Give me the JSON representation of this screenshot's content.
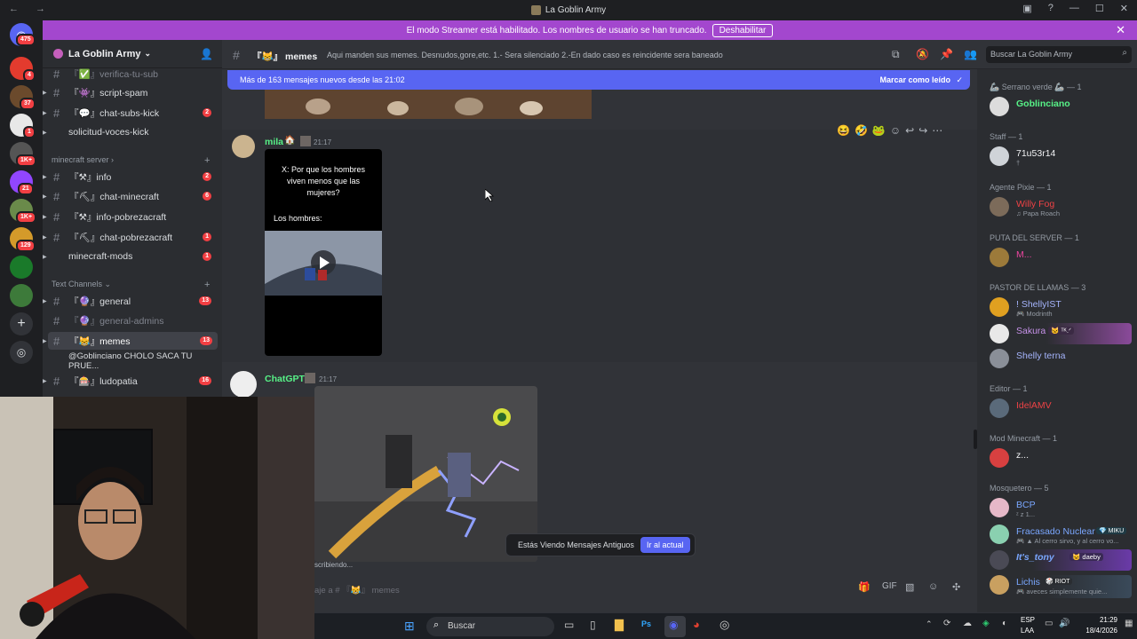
{
  "window": {
    "title": "La Goblin Army"
  },
  "banner": {
    "text": "El modo Streamer está habilitado. Los nombres de usuario se han truncado.",
    "button": "Deshabilitar"
  },
  "servers": {
    "badges": [
      "4",
      "37",
      "1",
      "1K+",
      "21",
      "1K+",
      "129"
    ],
    "top_badge": "475"
  },
  "guild": {
    "name": "La Goblin Army"
  },
  "channels": [
    {
      "name": "verifica-tu-sub",
      "prefix": "『✅』",
      "count": "",
      "muted": true
    },
    {
      "name": "script-spam",
      "prefix": "『👾』",
      "count": ""
    },
    {
      "name": "chat-subs-kick",
      "prefix": "『💬』",
      "count": "2"
    },
    {
      "name": "solicitud-voces-kick",
      "prefix": "",
      "count": ""
    }
  ],
  "categories": {
    "minecraft": "minecraft server",
    "text": "Text Channels"
  },
  "minecraft_channels": [
    {
      "name": "info",
      "prefix": "『⚒』",
      "count": "2"
    },
    {
      "name": "chat-minecraft",
      "prefix": "『⛏』",
      "count": "6"
    },
    {
      "name": "info-pobrezacraft",
      "prefix": "『⚒』",
      "count": ""
    },
    {
      "name": "chat-pobrezacraft",
      "prefix": "『⛏』",
      "count": "1"
    },
    {
      "name": "minecraft-mods",
      "prefix": "",
      "count": "1"
    }
  ],
  "text_channels": [
    {
      "name": "general",
      "prefix": "『🔮』",
      "count": "13"
    },
    {
      "name": "general-admins",
      "prefix": "『🔮』",
      "count": "",
      "muted": true
    },
    {
      "name": "memes",
      "prefix": "『😹』",
      "count": "13",
      "selected": true
    },
    {
      "name": "@Goblinciano CHOLO SACA TU PRUE...",
      "prefix": "",
      "count": "",
      "thread": true
    },
    {
      "name": "ludopatia",
      "prefix": "『🎰』",
      "count": "16"
    }
  ],
  "channel_header": {
    "prefix": "『😹』",
    "name": "memes",
    "topic": "Aqui manden sus memes. Desnudos,gore,etc. 1.- Sera silenciado 2.-En dado caso es reincidente sera baneado",
    "search_placeholder": "Buscar La Goblin Army"
  },
  "new_messages": {
    "text": "Más de 163 mensajes nuevos desde las 21:02",
    "mark_read": "Marcar como leído"
  },
  "messages": [
    {
      "author": "mila",
      "time": "21:17",
      "author_color": "#57f287",
      "meme_text": "X: Por que los hombres viven menos que las mujeres?",
      "meme_text2": "Los hombres:"
    },
    {
      "author": "ChatGPT",
      "time": "21:17",
      "author_color": "#57f287"
    }
  ],
  "typing": "scribiendo...",
  "jump": {
    "text": "Estás Viendo Mensajes Antiguos",
    "button": "Ir al actual"
  },
  "composer": {
    "placeholder": "aje a # 『😹』 memes"
  },
  "members": {
    "groups": [
      {
        "title": "🦾 Serrano verde 🦾 — 1"
      },
      {
        "title": "Staff — 1"
      },
      {
        "title": "Agente Pixie — 1"
      },
      {
        "title": "PUTA DEL SERVER — 1"
      },
      {
        "title": "PASTOR DE LLAMAS — 3"
      },
      {
        "title": "Editor — 1"
      },
      {
        "title": "Mod Minecraft — 1"
      },
      {
        "title": "Mosquetero — 5"
      }
    ],
    "list": [
      {
        "name": "Goblinciano",
        "color": "#57f287",
        "sub": ""
      },
      {
        "name": "71u53r14",
        "color": "#f2f3f5",
        "sub": "†"
      },
      {
        "name": "Willy Fog",
        "color": "#ed4245",
        "sub": "♫ Papa Roach"
      },
      {
        "name": "M...",
        "color": "#eb459e",
        "sub": ""
      },
      {
        "name": "! ShellyIST",
        "color": "#a5b4fc",
        "sub": "🎮 Modrinth"
      },
      {
        "name": "Sakura",
        "color": "#c792ea",
        "sub": "",
        "tag": "🐱 ᵀᴷ.ᐟ"
      },
      {
        "name": "Shelly terna",
        "color": "#a5b4fc",
        "sub": ""
      },
      {
        "name": "IdelAMV",
        "color": "#ed4245",
        "sub": ""
      },
      {
        "name": "z...",
        "color": "#f2f3f5",
        "sub": ""
      },
      {
        "name": "BCP",
        "color": "#7aa7ff",
        "sub": "ᶻ z 1..."
      },
      {
        "name": "Fracasado Nuclear",
        "color": "#7aa7ff",
        "sub": "🎮 ▲ Al cerro sirvo, y al cerro vo...",
        "tag": "💎 MIKU"
      },
      {
        "name": "It's_tony",
        "color": "#7aa7ff",
        "sub": "",
        "tag": "😺 daeby"
      },
      {
        "name": "Lichis",
        "color": "#7aa7ff",
        "sub": "🎮 aveces simplemente quie...",
        "tag": "🎲 RIOT"
      }
    ]
  },
  "taskbar": {
    "search": "Buscar",
    "lang": "ESP",
    "lang2": "LAA",
    "time": "21:29",
    "date": "18/4/2026"
  },
  "colors": {
    "accent": "#5865f2",
    "banner": "#a347ce",
    "mention": "#f23f43"
  }
}
